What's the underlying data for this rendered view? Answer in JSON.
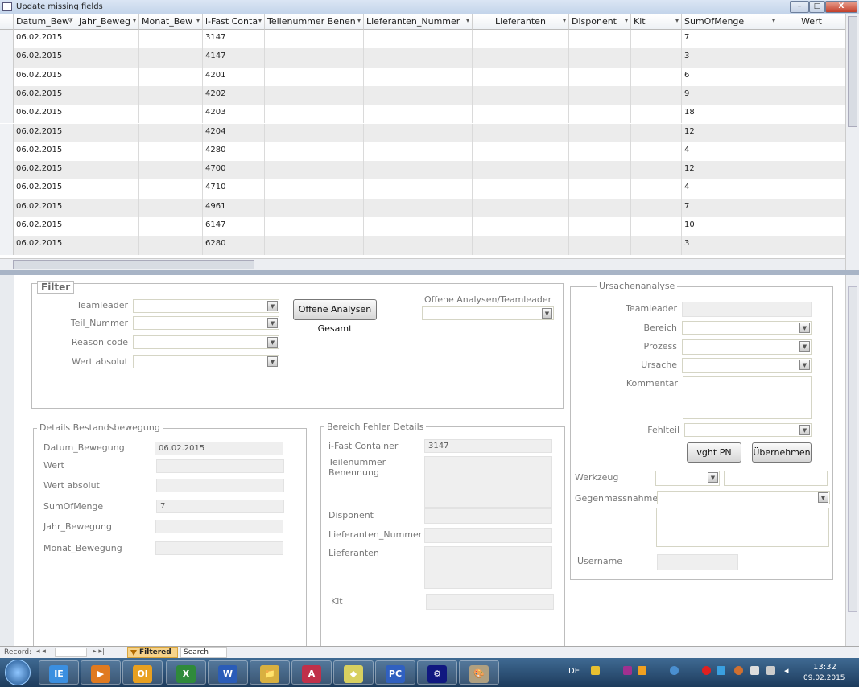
{
  "window": {
    "title": "Update missing fields",
    "min": "–",
    "max": "□",
    "close": "X"
  },
  "grid": {
    "columns": [
      "Datum_Bew",
      "Jahr_Beweg",
      "Monat_Bew",
      "i-Fast Conta",
      "Teilenummer Benen",
      "Lieferanten_Nummer",
      "Lieferanten",
      "Disponent",
      "Kit",
      "SumOfMenge",
      "Wert"
    ],
    "rows": [
      [
        "06.02.2015",
        "3147",
        "7"
      ],
      [
        "06.02.2015",
        "4147",
        "3"
      ],
      [
        "06.02.2015",
        "4201",
        "6"
      ],
      [
        "06.02.2015",
        "4202",
        "9"
      ],
      [
        "06.02.2015",
        "4203",
        "18"
      ],
      [
        "06.02.2015",
        "4204",
        "12"
      ],
      [
        "06.02.2015",
        "4280",
        "4"
      ],
      [
        "06.02.2015",
        "4700",
        "12"
      ],
      [
        "06.02.2015",
        "4710",
        "4"
      ],
      [
        "06.02.2015",
        "4961",
        "7"
      ],
      [
        "06.02.2015",
        "6147",
        "10"
      ],
      [
        "06.02.2015",
        "6280",
        "3"
      ]
    ]
  },
  "filter": {
    "title": "Filter",
    "teamleader": "Teamleader",
    "teil_nummer": "Teil_Nummer",
    "reason_code": "Reason code",
    "wert_absolut": "Wert absolut",
    "button": "Offene Analysen Gesamt",
    "offene_label": "Offene Analysen/Teamleader"
  },
  "details": {
    "title": "Details Bestandsbewegung",
    "datum_label": "Datum_Bewegung",
    "datum_value": "06.02.2015",
    "wert": "Wert",
    "wert_absolut": "Wert absolut",
    "sum_label": "SumOfMenge",
    "sum_value": "7",
    "jahr": "Jahr_Bewegung",
    "monat": "Monat_Bewegung"
  },
  "bereich": {
    "title": "Bereich Fehler Details",
    "ifast_label": "i-Fast Container",
    "ifast_value": "3147",
    "teilenummer": "Teilenummer Benennung",
    "disponent": "Disponent",
    "lief_nr": "Lieferanten_Nummer",
    "lieferanten": "Lieferanten",
    "kit": "Kit"
  },
  "ursache": {
    "title": "Ursachenanalyse",
    "teamleader": "Teamleader",
    "bereich": "Bereich",
    "prozess": "Prozess",
    "ursache": "Ursache",
    "kommentar": "Kommentar",
    "fehlteil": "Fehlteil",
    "vght": "vght PN",
    "uebernehmen": "Übernehmen",
    "werkzeug": "Werkzeug",
    "gegen": "Gegenmassnahme",
    "username": "Username"
  },
  "recordbar": {
    "record": "Record:",
    "filtered": "Filtered",
    "search": "Search"
  },
  "taskbar": {
    "lang": "DE",
    "time": "13:32",
    "date": "09.02.2015",
    "apps": [
      "IE",
      "▶",
      "Ol",
      "X",
      "W",
      "📁",
      "A",
      "◆",
      "PC",
      "⚙",
      "🎨"
    ]
  }
}
